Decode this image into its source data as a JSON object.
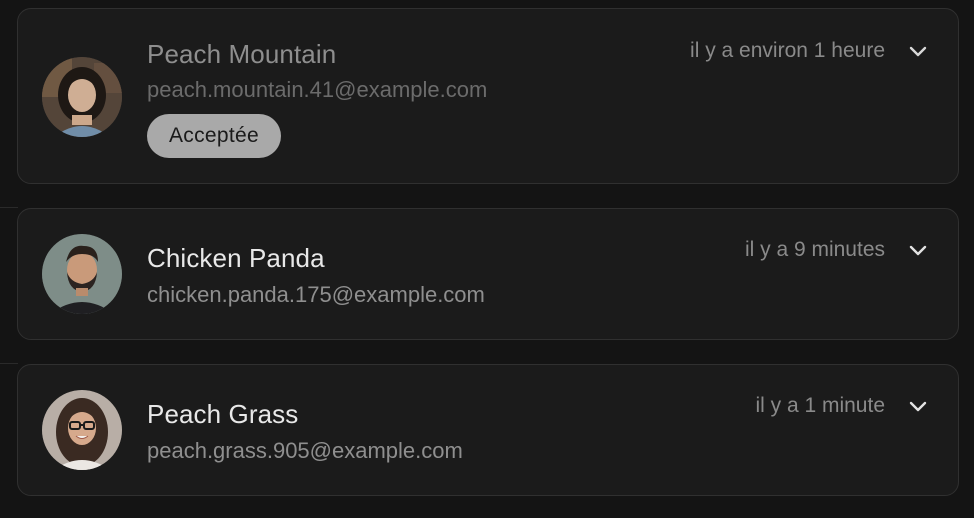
{
  "requests": [
    {
      "name": "Peach Mountain",
      "email": "peach.mountain.41@example.com",
      "time": "il y a environ 1 heure",
      "status": "Acceptée",
      "avatar": "woman-dark-hair-avatar"
    },
    {
      "name": "Chicken Panda",
      "email": "chicken.panda.175@example.com",
      "time": "il y a 9 minutes",
      "avatar": "man-beard-avatar"
    },
    {
      "name": "Peach Grass",
      "email": "peach.grass.905@example.com",
      "time": "il y a 1 minute",
      "avatar": "woman-glasses-avatar"
    }
  ],
  "icons": {
    "expand": "chevron-down-icon"
  },
  "colors": {
    "background": "#141414",
    "card": "#1b1b1b",
    "border": "#303030",
    "badge": "#a9a9a9"
  }
}
